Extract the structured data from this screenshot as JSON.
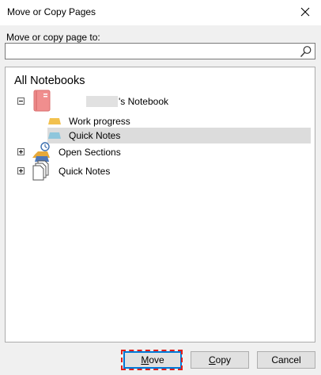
{
  "window": {
    "title": "Move or Copy Pages"
  },
  "prompt": {
    "label": "Move or copy page to:"
  },
  "search": {
    "value": "",
    "placeholder": ""
  },
  "tree": {
    "header": "All Notebooks",
    "notebook": {
      "name_suffix": "'s Notebook",
      "owner_redacted": true,
      "expanded": true
    },
    "sections": [
      {
        "label": "Work progress",
        "color": "#f2c14e"
      },
      {
        "label": "Quick Notes",
        "color": "#8ec6dc",
        "selected": true
      }
    ],
    "roots": [
      {
        "label": "Open Sections",
        "expanded": false
      },
      {
        "label": "Quick Notes",
        "expanded": false
      }
    ]
  },
  "buttons": {
    "move": {
      "prefix": "",
      "accel": "M",
      "rest": "ove"
    },
    "copy": {
      "prefix": "",
      "accel": "C",
      "rest": "opy"
    },
    "cancel": {
      "label": "Cancel"
    }
  },
  "colors": {
    "notebook_icon": "#f08e8e",
    "primary_border": "#0078d7",
    "focus_outline": "#e0201c",
    "selection": "#dcdcdc"
  }
}
